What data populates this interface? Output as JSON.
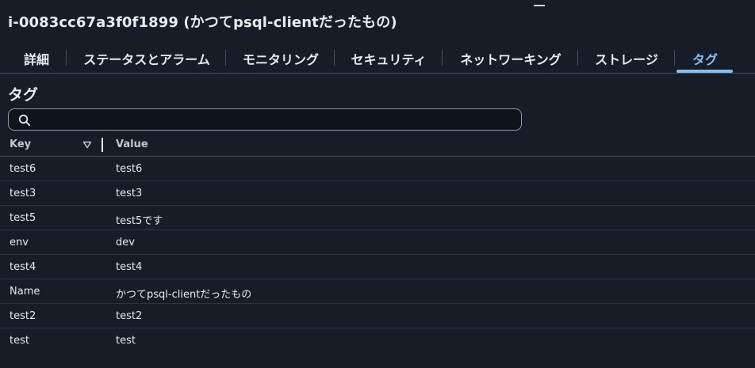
{
  "instance": {
    "title": "i-0083cc67a3f0f1899 (かつてpsql-clientだったもの)"
  },
  "tabs": [
    {
      "label": "詳細",
      "active": false
    },
    {
      "label": "ステータスとアラーム",
      "active": false
    },
    {
      "label": "モニタリング",
      "active": false
    },
    {
      "label": "セキュリティ",
      "active": false
    },
    {
      "label": "ネットワーキング",
      "active": false
    },
    {
      "label": "ストレージ",
      "active": false
    },
    {
      "label": "タグ",
      "active": true
    }
  ],
  "section": {
    "title": "タグ"
  },
  "search": {
    "value": "",
    "placeholder": ""
  },
  "table": {
    "columns": {
      "key": "Key",
      "value": "Value"
    },
    "rows": [
      {
        "key": "test6",
        "value": "test6"
      },
      {
        "key": "test3",
        "value": "test3"
      },
      {
        "key": "test5",
        "value": "test5です"
      },
      {
        "key": "env",
        "value": "dev"
      },
      {
        "key": "test4",
        "value": "test4"
      },
      {
        "key": "Name",
        "value": "かつてpsql-clientだったもの"
      },
      {
        "key": "test2",
        "value": "test2"
      },
      {
        "key": "test",
        "value": "test"
      }
    ]
  },
  "colors": {
    "background": "#161d26",
    "text": "#e9ebed",
    "accent": "#89bdee",
    "divider": "#414d5c"
  }
}
